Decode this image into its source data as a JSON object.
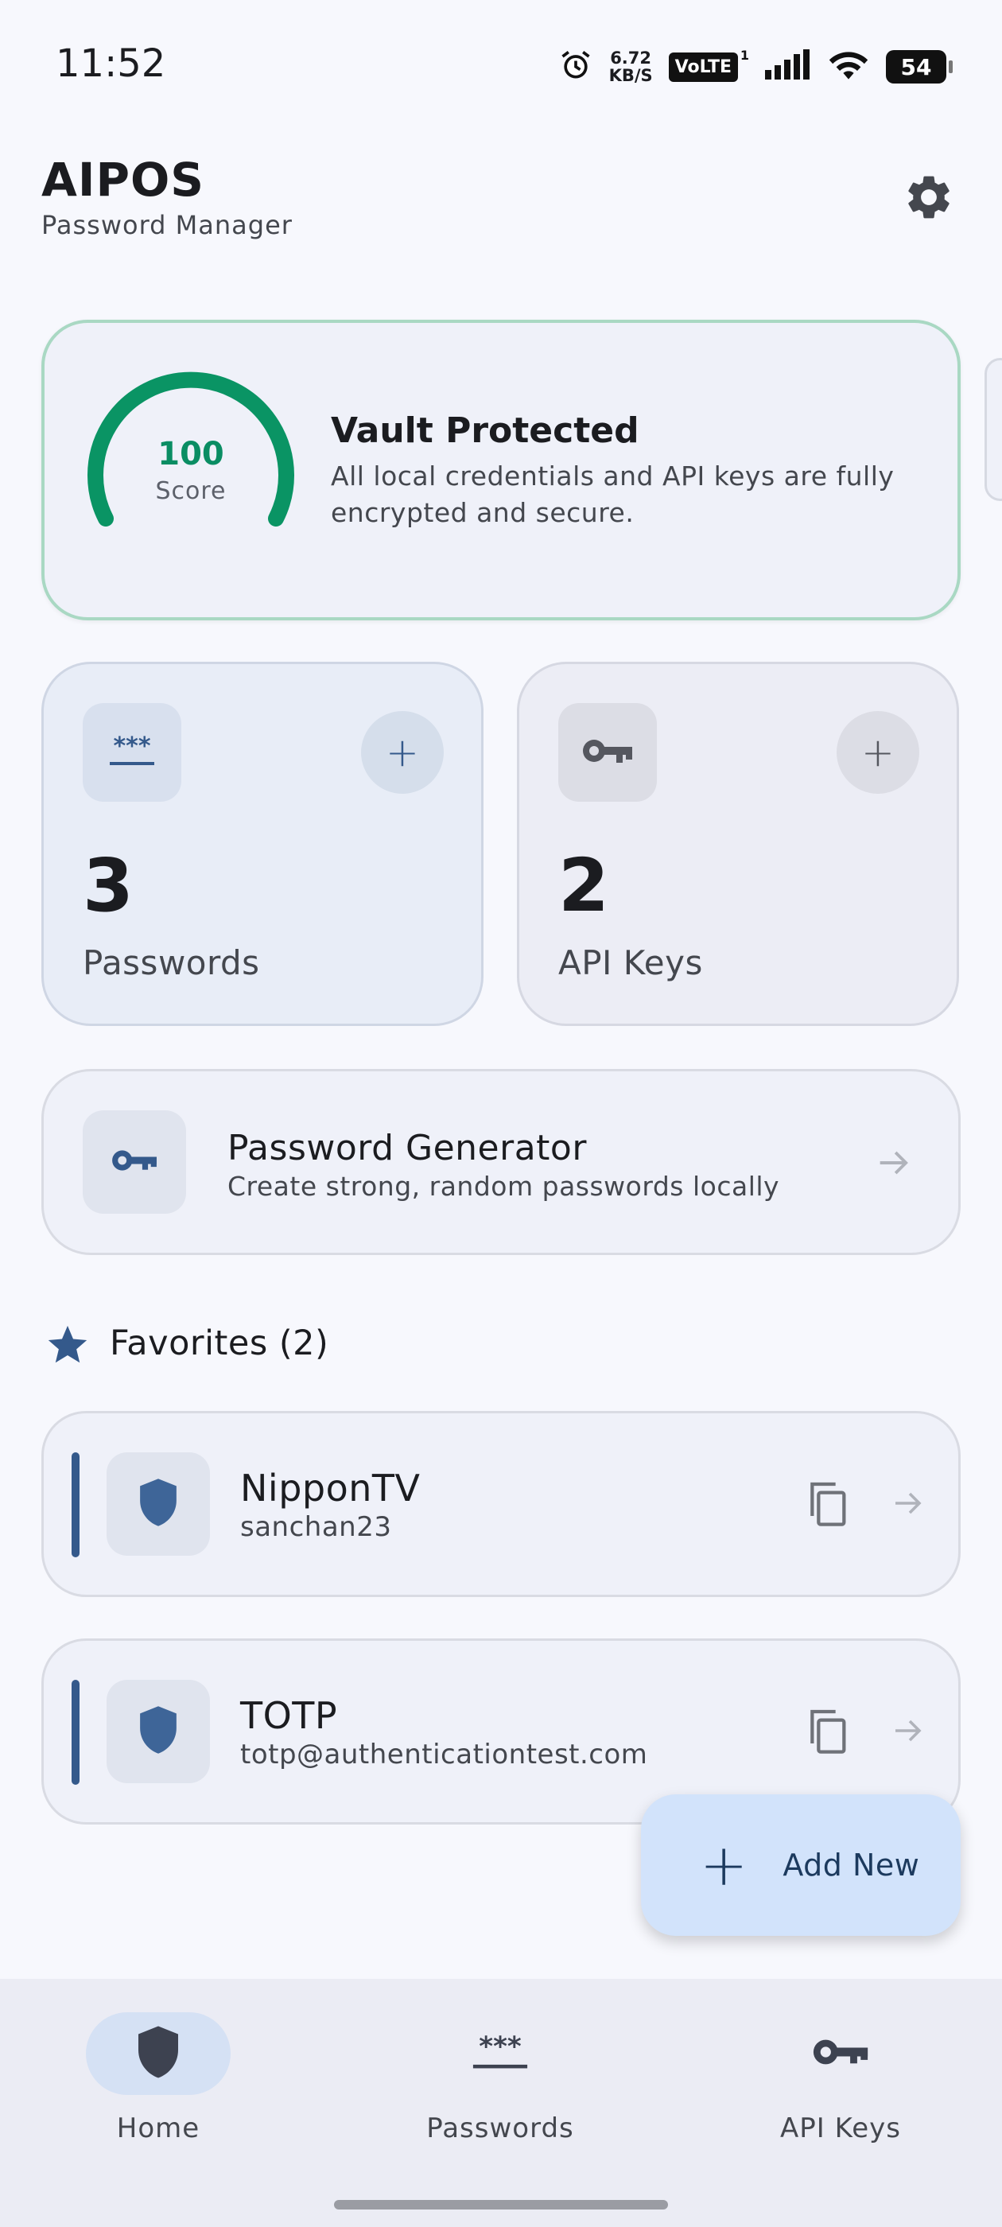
{
  "status_bar": {
    "time": "11:52",
    "net_speed_value": "6.72",
    "net_speed_unit": "KB/S",
    "volte": "VoLTE",
    "volte_sim": "1",
    "battery": "54"
  },
  "header": {
    "title": "AIPOS",
    "subtitle": "Password Manager"
  },
  "vault": {
    "score": "100",
    "score_label": "Score",
    "title": "Vault Protected",
    "description": "All local credentials and API keys are fully encrypted and secure.",
    "accent_color": "#0a9464"
  },
  "stats": {
    "passwords": {
      "count": "3",
      "label": "Passwords",
      "add": "+"
    },
    "api_keys": {
      "count": "2",
      "label": "API Keys",
      "add": "+"
    }
  },
  "generator": {
    "title": "Password Generator",
    "description": "Create strong, random passwords locally"
  },
  "favorites": {
    "title": "Favorites (2)",
    "items": [
      {
        "name": "NipponTV",
        "username": "sanchan23"
      },
      {
        "name": "TOTP",
        "username": "totp@authenticationtest.com"
      }
    ]
  },
  "fab": {
    "plus": "+",
    "label": "Add New"
  },
  "bottom_nav": {
    "items": [
      {
        "label": "Home",
        "icon": "shield-icon",
        "active": true
      },
      {
        "label": "Passwords",
        "icon": "password-dots-icon",
        "active": false
      },
      {
        "label": "API Keys",
        "icon": "key-icon",
        "active": false
      }
    ]
  },
  "colors": {
    "primary": "#34598b",
    "success": "#0a9464",
    "background": "#f7f8fd"
  }
}
